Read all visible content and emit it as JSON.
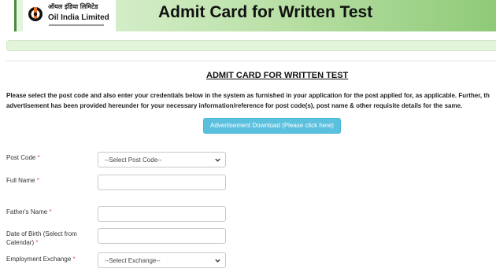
{
  "header": {
    "logo_hindi": "ऑयल इंडिया लिमिटेड",
    "logo_name": "Oil India Limited",
    "title": "Admit Card for Written Test"
  },
  "main": {
    "section_title": "ADMIT CARD FOR WRITTEN TEST",
    "intro_line1": "Please select the post code and also enter your credentials below in the system as furnished in your application for the post applied for, as applicable. Further, th",
    "intro_line2": "advertisement has been provided hereunder for your necessary information/reference for post code(s), post name & other requisite details for the same.",
    "advertisement_button": "Advertisement Download (Please click here)"
  },
  "form": {
    "post_code_label": "Post Code",
    "post_code_value": "--Select Post Code--",
    "full_name_label": "Full Name",
    "full_name_value": "",
    "fathers_name_label": "Father's Name",
    "fathers_name_value": "",
    "dob_label_line1": "Date of Birth (Select from",
    "dob_label_line2": "Calendar)",
    "dob_value": "",
    "employment_exchange_label": "Employment Exchange",
    "employment_exchange_value": "--Select Exchange--",
    "required_marker": "*"
  },
  "colors": {
    "header_gradient_end": "#8fca78",
    "button_bg": "#5bc0de",
    "required": "#d9534f"
  },
  "icons": {
    "logo": "oil-india-logo",
    "dropdown": "chevron-down-icon"
  }
}
